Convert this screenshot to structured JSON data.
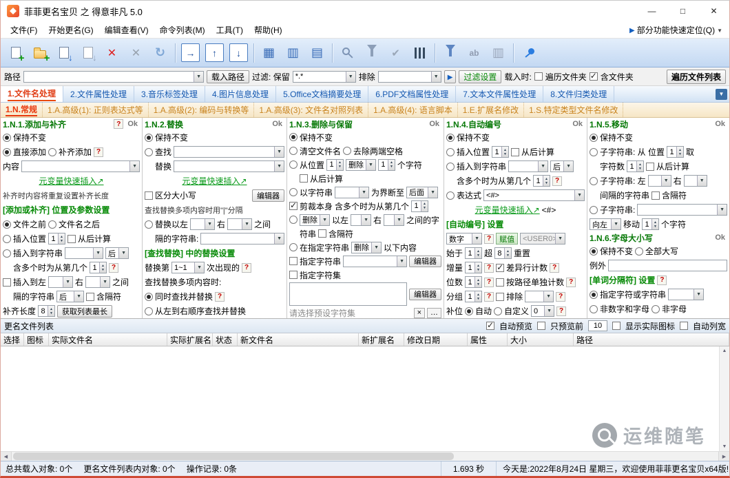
{
  "ui": {
    "help": "?",
    "ok": "Ok",
    "close": "×",
    "more": "…",
    "min": "—",
    "max": "□",
    "x": "✕"
  },
  "titlebar": {
    "title": "菲菲更名宝贝 之 得意非凡 5.0"
  },
  "menubar": {
    "items": [
      "文件(F)",
      "开始更名(G)",
      "编辑查看(V)",
      "命令列表(M)",
      "工具(T)",
      "帮助(H)"
    ],
    "quick": "部分功能快速定位(Q)"
  },
  "toolbar": {
    "icons": [
      "add-files",
      "add-folder",
      "load-list",
      "export-list",
      "remove",
      "remove-all",
      "refresh",
      "start-rename",
      "move-up",
      "move-down",
      "column-view",
      "table-view",
      "checklist-view",
      "search",
      "filter-text",
      "confirm",
      "adjust",
      "filter",
      "rename-tools",
      "archive",
      "pin"
    ]
  },
  "pathbar": {
    "path_label": "路径",
    "load_path": "载入路径",
    "filter_label": "过滤: 保留",
    "filter_value": "*.*",
    "exclude_label": "排除",
    "filter_settings": "过滤设置",
    "load_on": "载入时:",
    "traverse": "遍历文件夹",
    "include_folders": "含文件夹",
    "traverse_list": "遍历文件列表"
  },
  "tabs1": [
    {
      "label": "1.文件名处理",
      "active": true
    },
    {
      "label": "2.文件属性处理"
    },
    {
      "label": "3.音乐标签处理"
    },
    {
      "label": "4.图片信息处理"
    },
    {
      "label": "5.Office文档摘要处理"
    },
    {
      "label": "6.PDF文档属性处理"
    },
    {
      "label": "7.文本文件属性处理"
    },
    {
      "label": "8.文件归类处理"
    }
  ],
  "tabs2": [
    {
      "label": "1.N.常规",
      "active": true
    },
    {
      "label": "1.A.高级(1): 正则表达式等"
    },
    {
      "label": "1.A.高级(2): 编码与转换等"
    },
    {
      "label": "1.A.高级(3): 文件名对照列表"
    },
    {
      "label": "1.A.高级(4): 语言脚本"
    },
    {
      "label": "1.E.扩展名修改"
    },
    {
      "label": "1.S.特定类型文件名修改"
    }
  ],
  "p1": {
    "title": "1.N.1.添加与补齐",
    "keep": "保持不变",
    "direct": "直接添加",
    "pad": "补齐添加",
    "content": "内容",
    "meta": "元变量快速插入↗",
    "note": "补齐时内容将重复设置补齐长度",
    "section": "[添加或补齐] 位置及参数设置",
    "before": "文件之前",
    "after": "文件名之后",
    "ins_pos": "插入位置",
    "pos": "1",
    "from_end": "从后计算",
    "ins_str": "插入到字符串",
    "after_dd": "后",
    "nth": "含多个时为从第几个",
    "nth_val": "1",
    "ins_between": "插入到左",
    "right": "右",
    "between": "之间",
    "sep": "隔的字符串",
    "sep_val": "后",
    "incl": "含隔符",
    "pad_len": "补齐长度",
    "pad_val": "8",
    "get_max": "获取列表最长"
  },
  "p2": {
    "title": "1.N.2.替换",
    "keep": "保持不变",
    "find": "查找",
    "repl": "替换",
    "meta": "元变量快速插入↗",
    "case": "区分大小写",
    "editor": "编辑器",
    "note": "查找替换多项内容时用\"|\"分隔",
    "rep_between": "替换以左",
    "right": "右",
    "between": "之间",
    "sep": "隔的字符串:",
    "section": "[查找替换] 中的替换设置",
    "nth_pre": "替换第",
    "nth_val": "1~1",
    "nth_post": "次出现的",
    "multi": "查找替换多项内容时:",
    "simul": "同时查找并替换",
    "seq": "从左到右顺序查找并替换"
  },
  "p3": {
    "title": "1.N.3.删除与保留",
    "keep": "保持不变",
    "clear": "清空文件名",
    "trim": "去除两端空格",
    "from_pos": "从位置",
    "pos": "1",
    "del": "删除",
    "cnt": "1",
    "chars": "个字符",
    "from_end": "从后计算",
    "by_str": "以字符串",
    "bound": "为界断至",
    "side": "后面",
    "cut": "剪裁本身",
    "nth": "含多个时为从第几个",
    "nth_val": "1",
    "left": "以左",
    "right": "右",
    "between": "之间的字",
    "str2": "符串",
    "incl": "含隔符",
    "at_str": "在指定字符串",
    "below": "以下内容",
    "spec": "指定字符串",
    "editor": "编辑器",
    "charset": "指定字符集",
    "preset": "请选择预设字符集"
  },
  "p4": {
    "title": "1.N.4.自动编号",
    "keep": "保持不变",
    "ins_pos": "插入位置",
    "pos": "1",
    "from_end": "从后计算",
    "ins_str": "插入到字符串",
    "after_dd": "后",
    "nth": "含多个时为从第几个",
    "nth_val": "1",
    "expr": "表达式",
    "expr_val": "<#>",
    "meta": "元变量快速插入↗",
    "tag": "<#>",
    "section": "[自动编号] 设置",
    "type": "数字",
    "assign": "赋值",
    "assign_val": "<USER0>",
    "start": "始于",
    "start_val": "1",
    "over": "超",
    "over_val": "8",
    "reset": "重置",
    "inc": "增量",
    "inc_val": "1",
    "diff": "差异行计数",
    "digits": "位数",
    "digits_val": "1",
    "per_path": "按路径单独计数",
    "group": "分组",
    "group_val": "1",
    "excl": "排除",
    "fill": "补位",
    "auto": "自动",
    "custom": "自定义",
    "custom_val": "0"
  },
  "p5": {
    "title": "1.N.5.移动",
    "keep": "保持不变",
    "sub1": "子字符串: 从 位置",
    "pos": "1",
    "take": "取",
    "cnt_lbl": "字符数",
    "cnt": "1",
    "from_end": "从后计算",
    "sub2": "子字符串: 左",
    "right": "右",
    "sep": "间隔的字符串",
    "incl": "含隔符",
    "sub3": "子字符串:",
    "dir": "向左",
    "move": "移动",
    "move_val": "1",
    "chars": "个字符"
  },
  "p6": {
    "title": "1.N.6.字母大小写",
    "keep": "保持不变",
    "upper": "全部大写",
    "except": "例外",
    "section": "[单词分隔符] 设置",
    "spec": "指定字符或字符串",
    "non_alnum": "非数字和字母",
    "non_alpha": "非字母"
  },
  "list": {
    "title": "更名文件列表",
    "auto_preview": "自动预览",
    "preview_first": "只预览前",
    "preview_n": "10",
    "show_icon": "显示实际图标",
    "auto_width": "自动列宽",
    "columns": [
      "选择",
      "图标",
      "实际文件名",
      "实际扩展名",
      "状态",
      "新文件名",
      "新扩展名",
      "修改日期",
      "属性",
      "大小",
      "路径"
    ]
  },
  "watermark": {
    "text": "运维随笔"
  },
  "statusbar": {
    "counts": [
      "总共载入对象: 0个",
      "更名文件列表内对象: 0个",
      "操作记录: 0条"
    ],
    "time": "1.693 秒",
    "right": "今天是:2022年8月24日 星期三，欢迎使用菲菲更名宝贝x64版!"
  }
}
